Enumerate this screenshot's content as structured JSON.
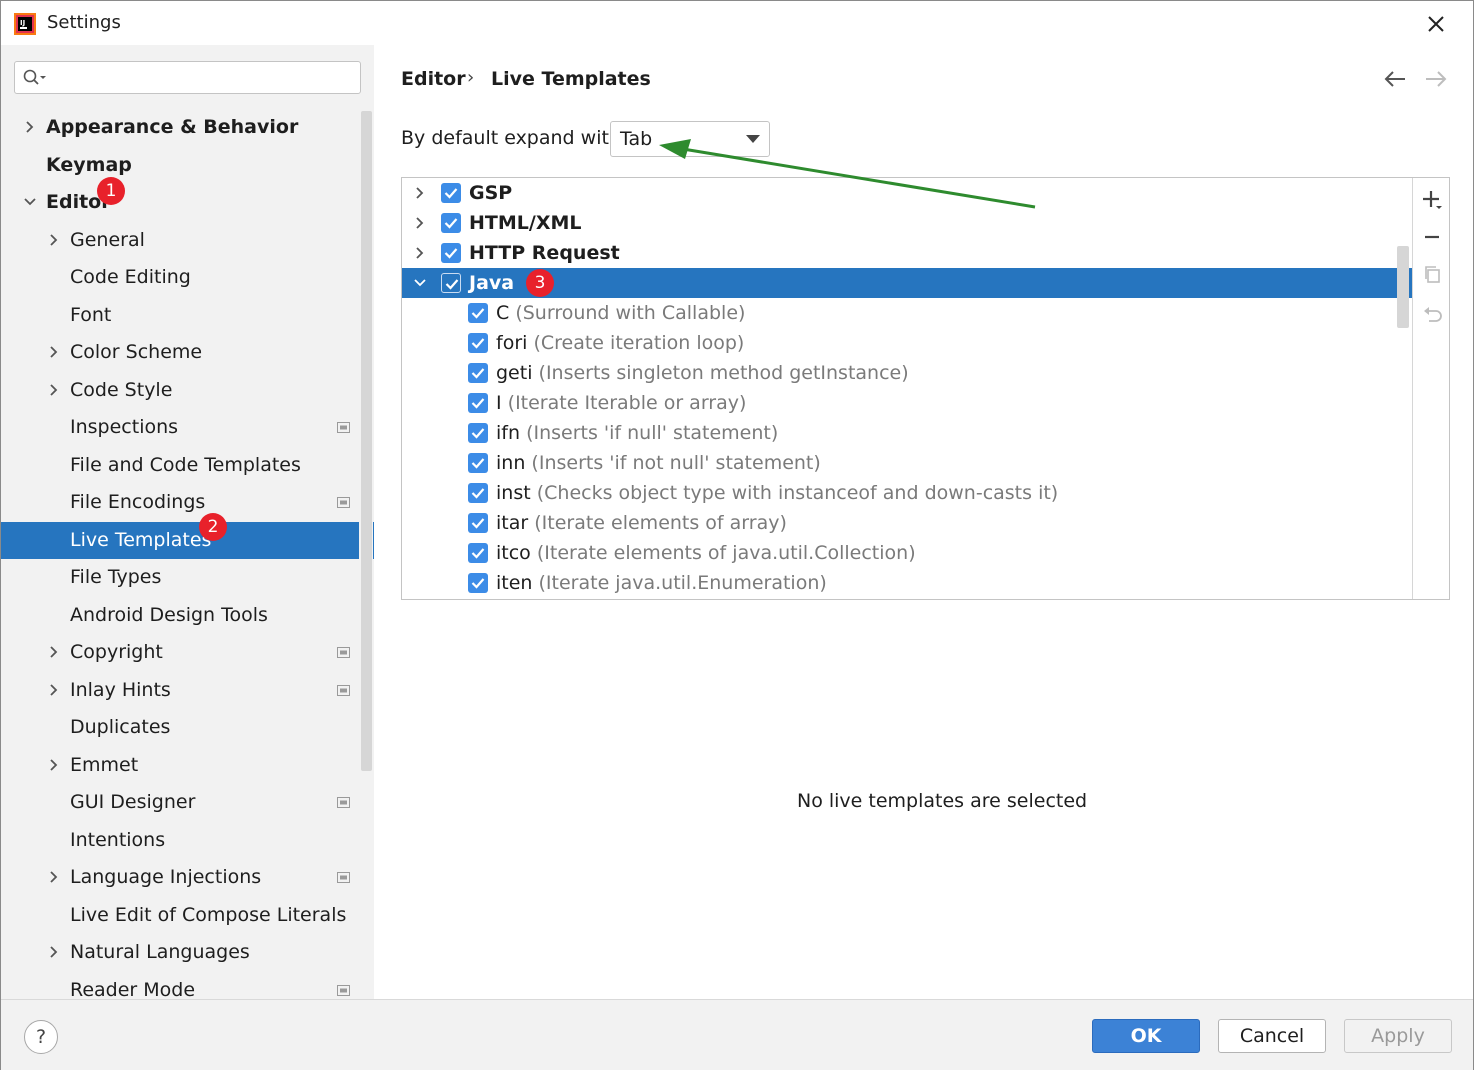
{
  "window": {
    "title": "Settings",
    "icon": "intellij-idea-icon"
  },
  "search": {
    "value": "",
    "placeholder": ""
  },
  "sidebar": {
    "items": [
      {
        "label": "Appearance & Behavior",
        "level": 0,
        "expandable": true,
        "expanded": false,
        "bold": true
      },
      {
        "label": "Keymap",
        "level": 0,
        "expandable": false,
        "bold": true
      },
      {
        "label": "Editor",
        "level": 0,
        "expandable": true,
        "expanded": true,
        "bold": true,
        "badge": "1"
      },
      {
        "label": "General",
        "level": 1,
        "expandable": true
      },
      {
        "label": "Code Editing",
        "level": 1
      },
      {
        "label": "Font",
        "level": 1
      },
      {
        "label": "Color Scheme",
        "level": 1,
        "expandable": true
      },
      {
        "label": "Code Style",
        "level": 1,
        "expandable": true
      },
      {
        "label": "Inspections",
        "level": 1,
        "project_icon": true
      },
      {
        "label": "File and Code Templates",
        "level": 1
      },
      {
        "label": "File Encodings",
        "level": 1,
        "project_icon": true
      },
      {
        "label": "Live Templates",
        "level": 1,
        "selected": true,
        "badge": "2"
      },
      {
        "label": "File Types",
        "level": 1
      },
      {
        "label": "Android Design Tools",
        "level": 1
      },
      {
        "label": "Copyright",
        "level": 1,
        "expandable": true,
        "project_icon": true
      },
      {
        "label": "Inlay Hints",
        "level": 1,
        "expandable": true,
        "project_icon": true
      },
      {
        "label": "Duplicates",
        "level": 1
      },
      {
        "label": "Emmet",
        "level": 1,
        "expandable": true
      },
      {
        "label": "GUI Designer",
        "level": 1,
        "project_icon": true
      },
      {
        "label": "Intentions",
        "level": 1
      },
      {
        "label": "Language Injections",
        "level": 1,
        "expandable": true,
        "project_icon": true
      },
      {
        "label": "Live Edit of Compose Literals",
        "level": 1
      },
      {
        "label": "Natural Languages",
        "level": 1,
        "expandable": true
      },
      {
        "label": "Reader Mode",
        "level": 1,
        "project_icon": true
      }
    ]
  },
  "breadcrumb": {
    "parent": "Editor",
    "separator": "›",
    "current": "Live Templates"
  },
  "expand_with": {
    "label": "By default expand with",
    "value": "Tab"
  },
  "templates": {
    "rows": [
      {
        "group": true,
        "name": "GSP",
        "expanded": false
      },
      {
        "group": true,
        "name": "HTML/XML",
        "expanded": false
      },
      {
        "group": true,
        "name": "HTTP Request",
        "expanded": false
      },
      {
        "group": true,
        "name": "Java",
        "expanded": true,
        "selected": true,
        "badge": "3"
      },
      {
        "group": false,
        "name": "C",
        "desc": "(Surround with Callable)"
      },
      {
        "group": false,
        "name": "fori",
        "desc": "(Create iteration loop)"
      },
      {
        "group": false,
        "name": "geti",
        "desc": "(Inserts singleton method getInstance)"
      },
      {
        "group": false,
        "name": "I",
        "desc": "(Iterate Iterable or array)"
      },
      {
        "group": false,
        "name": "ifn",
        "desc": "(Inserts 'if null' statement)"
      },
      {
        "group": false,
        "name": "inn",
        "desc": "(Inserts 'if not null' statement)"
      },
      {
        "group": false,
        "name": "inst",
        "desc": "(Checks object type with instanceof and down-casts it)"
      },
      {
        "group": false,
        "name": "itar",
        "desc": "(Iterate elements of array)"
      },
      {
        "group": false,
        "name": "itco",
        "desc": "(Iterate elements of java.util.Collection)"
      },
      {
        "group": false,
        "name": "iten",
        "desc": "(Iterate java.util.Enumeration)"
      }
    ],
    "empty_message": "No live templates are selected"
  },
  "toolbar": {
    "add": "plus-icon",
    "remove": "minus-icon",
    "copy": "copy-icon",
    "revert": "undo-icon"
  },
  "footer": {
    "help": "?",
    "ok": "OK",
    "cancel": "Cancel",
    "apply": "Apply"
  },
  "colors": {
    "selection": "#2675bf",
    "checkbox": "#3c8ce7",
    "badge": "#e8212b",
    "annotation_arrow": "#2e8b2e"
  }
}
